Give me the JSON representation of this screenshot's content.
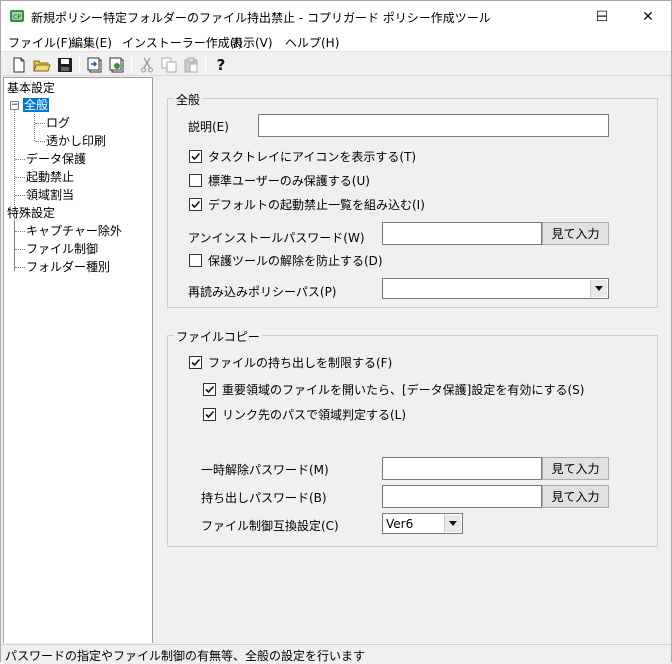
{
  "window": {
    "title": "新規ポリシー特定フォルダーのファイル持出禁止 - コプリガード ポリシー作成ツール",
    "minimize_glyph": "─",
    "maximize_glyph": "☐",
    "close_glyph": "✕"
  },
  "menu": [
    {
      "label": "ファイル(F)"
    },
    {
      "label": "編集(E)"
    },
    {
      "label": "インストーラー作成(I)"
    },
    {
      "label": "表示(V)"
    },
    {
      "label": "ヘルプ(H)"
    }
  ],
  "toolbar_icons": [
    "new-document-icon",
    "open-folder-icon",
    "save-disk-icon",
    "export-icon",
    "import-icon",
    "cut-icon",
    "copy-icon",
    "paste-icon",
    "help-icon"
  ],
  "tree": {
    "nodes": [
      {
        "label": "基本設定"
      },
      {
        "label": "全般"
      },
      {
        "label": "ログ"
      },
      {
        "label": "透かし印刷"
      },
      {
        "label": "データ保護"
      },
      {
        "label": "起動禁止"
      },
      {
        "label": "領域割当"
      },
      {
        "label": "特殊設定"
      },
      {
        "label": "キャプチャー除外"
      },
      {
        "label": "ファイル制御"
      },
      {
        "label": "フォルダー種別"
      }
    ],
    "selected": "全般"
  },
  "general": {
    "group_title": "全般",
    "description_label": "説明(E)",
    "description_value": "",
    "checks": [
      {
        "label": "タスクトレイにアイコンを表示する(T)",
        "checked": true
      },
      {
        "label": "標準ユーザーのみ保護する(U)",
        "checked": false
      },
      {
        "label": "デフォルトの起動禁止一覧を組み込む(I)",
        "checked": true
      }
    ],
    "uninstall_pw_label": "アンインストールパスワード(W)",
    "uninstall_pw_value": "",
    "view_input_label": "見て入力",
    "prevent_unprotect": {
      "label": "保護ツールの解除を防止する(D)",
      "checked": false
    },
    "reload_policy_label": "再読み込みポリシーパス(P)",
    "reload_policy_value": ""
  },
  "filecopy": {
    "group_title": "ファイルコピー",
    "restrict": {
      "label": "ファイルの持ち出しを制限する(F)",
      "checked": true
    },
    "important_area": {
      "label": "重要領域のファイルを開いたら、[データ保護]設定を有効にする(S)",
      "checked": true
    },
    "link_path": {
      "label": "リンク先のパスで領域判定する(L)",
      "checked": true
    },
    "temp_release_label": "一時解除パスワード(M)",
    "temp_release_value": "",
    "takeout_pw_label": "持ち出しパスワード(B)",
    "takeout_pw_value": "",
    "view_input_label": "見て入力",
    "compat_label": "ファイル制御互換設定(C)",
    "compat_value": "Ver6"
  },
  "status": {
    "text": "パスワードの指定やファイル制御の有無等、全般の設定を行います"
  }
}
